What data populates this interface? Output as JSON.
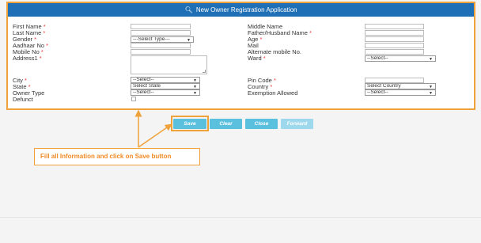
{
  "header": {
    "title": "New Owner Registration Application",
    "icon": "search-icon"
  },
  "left_fields": [
    {
      "label": "First Name",
      "required": true
    },
    {
      "label": "Last Name",
      "required": true
    },
    {
      "label": "Gender",
      "required": true
    },
    {
      "label": "Aadhaar No",
      "required": true
    },
    {
      "label": "Mobile No",
      "required": true
    },
    {
      "label": "Address1",
      "required": true
    },
    {
      "label": "City",
      "required": true
    },
    {
      "label": "State",
      "required": true
    },
    {
      "label": "Owner Type",
      "required": false
    },
    {
      "label": "Defunct",
      "required": false
    }
  ],
  "right_fields": [
    {
      "label": "Middle Name",
      "required": false
    },
    {
      "label": "Father/Husband Name",
      "required": true
    },
    {
      "label": "Age",
      "required": true
    },
    {
      "label": "Mail",
      "required": false
    },
    {
      "label": "Alternate mobile No.",
      "required": false
    },
    {
      "label": "Ward",
      "required": true
    },
    {
      "label": "Pin Code",
      "required": true
    },
    {
      "label": "Country",
      "required": true
    },
    {
      "label": "Exemption Allowed",
      "required": false
    }
  ],
  "selects": {
    "gender": "---Select Type---",
    "city": "--Select--",
    "state": "Select State",
    "owner_type": "--Select--",
    "ward": "--Select--",
    "country": "Select Country",
    "exemption": "--Select--"
  },
  "buttons": {
    "save": "Save",
    "clear": "Clear",
    "close": "Close",
    "forward": "Forward"
  },
  "callout": "Fill all Information and click on Save button",
  "colors": {
    "header": "#1e6fb5",
    "accent": "#f0a23a",
    "button": "#5bc0de"
  }
}
